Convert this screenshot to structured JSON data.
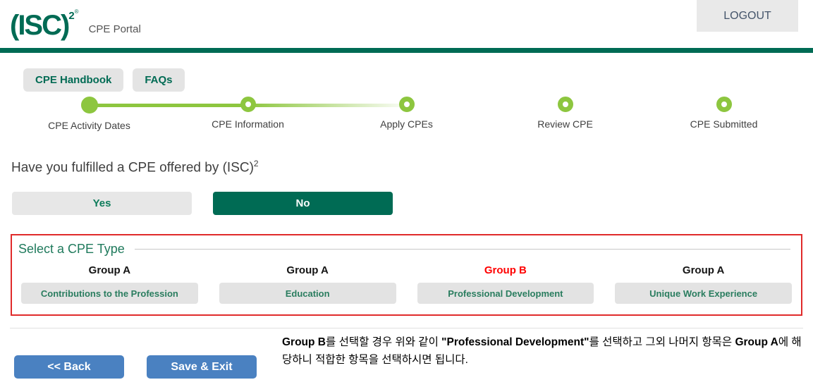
{
  "header": {
    "logo_text": "(ISC)",
    "logo_sup": "2",
    "logo_reg": "®",
    "app_title": "CPE Portal",
    "logout_label": "LOGOUT"
  },
  "toolbar": {
    "handbook_label": "CPE Handbook",
    "faqs_label": "FAQs"
  },
  "stepper": {
    "steps": [
      {
        "label": "CPE Activity Dates",
        "state": "complete"
      },
      {
        "label": "CPE Information",
        "state": "upcoming"
      },
      {
        "label": "Apply CPEs",
        "state": "upcoming"
      },
      {
        "label": "Review CPE",
        "state": "upcoming"
      },
      {
        "label": "CPE Submitted",
        "state": "upcoming"
      }
    ]
  },
  "question": {
    "text": "Have you fulfilled a CPE offered by (ISC)",
    "sup": "2",
    "yes_label": "Yes",
    "no_label": "No",
    "selected": "No"
  },
  "cpe_type": {
    "legend": "Select a CPE Type",
    "options": [
      {
        "group": "Group A",
        "label": "Contributions to the Profession",
        "highlight": false
      },
      {
        "group": "Group A",
        "label": "Education",
        "highlight": false
      },
      {
        "group": "Group B",
        "label": "Professional Development",
        "highlight": true
      },
      {
        "group": "Group A",
        "label": "Unique Work Experience",
        "highlight": false
      }
    ]
  },
  "note": {
    "segments": [
      {
        "text": "Group B",
        "bold": true
      },
      {
        "text": "를 선택할 경우 위와 같이 ",
        "bold": false
      },
      {
        "text": "\"Professional Development\"",
        "bold": true
      },
      {
        "text": "를 선택하고 그외 나머지 항목은 ",
        "bold": false
      },
      {
        "text": "Group A",
        "bold": true
      },
      {
        "text": "에 해당하니 적합한 항목을 선택하시면 됩니다.",
        "bold": false
      }
    ]
  },
  "footer": {
    "back_label": "<< Back",
    "save_exit_label": "Save & Exit"
  },
  "colors": {
    "brand_green": "#006B54",
    "step_green": "#8DC63F",
    "action_blue": "#4A81C1",
    "alert_red": "#E02B2B",
    "group_b_red": "#FF0000"
  }
}
